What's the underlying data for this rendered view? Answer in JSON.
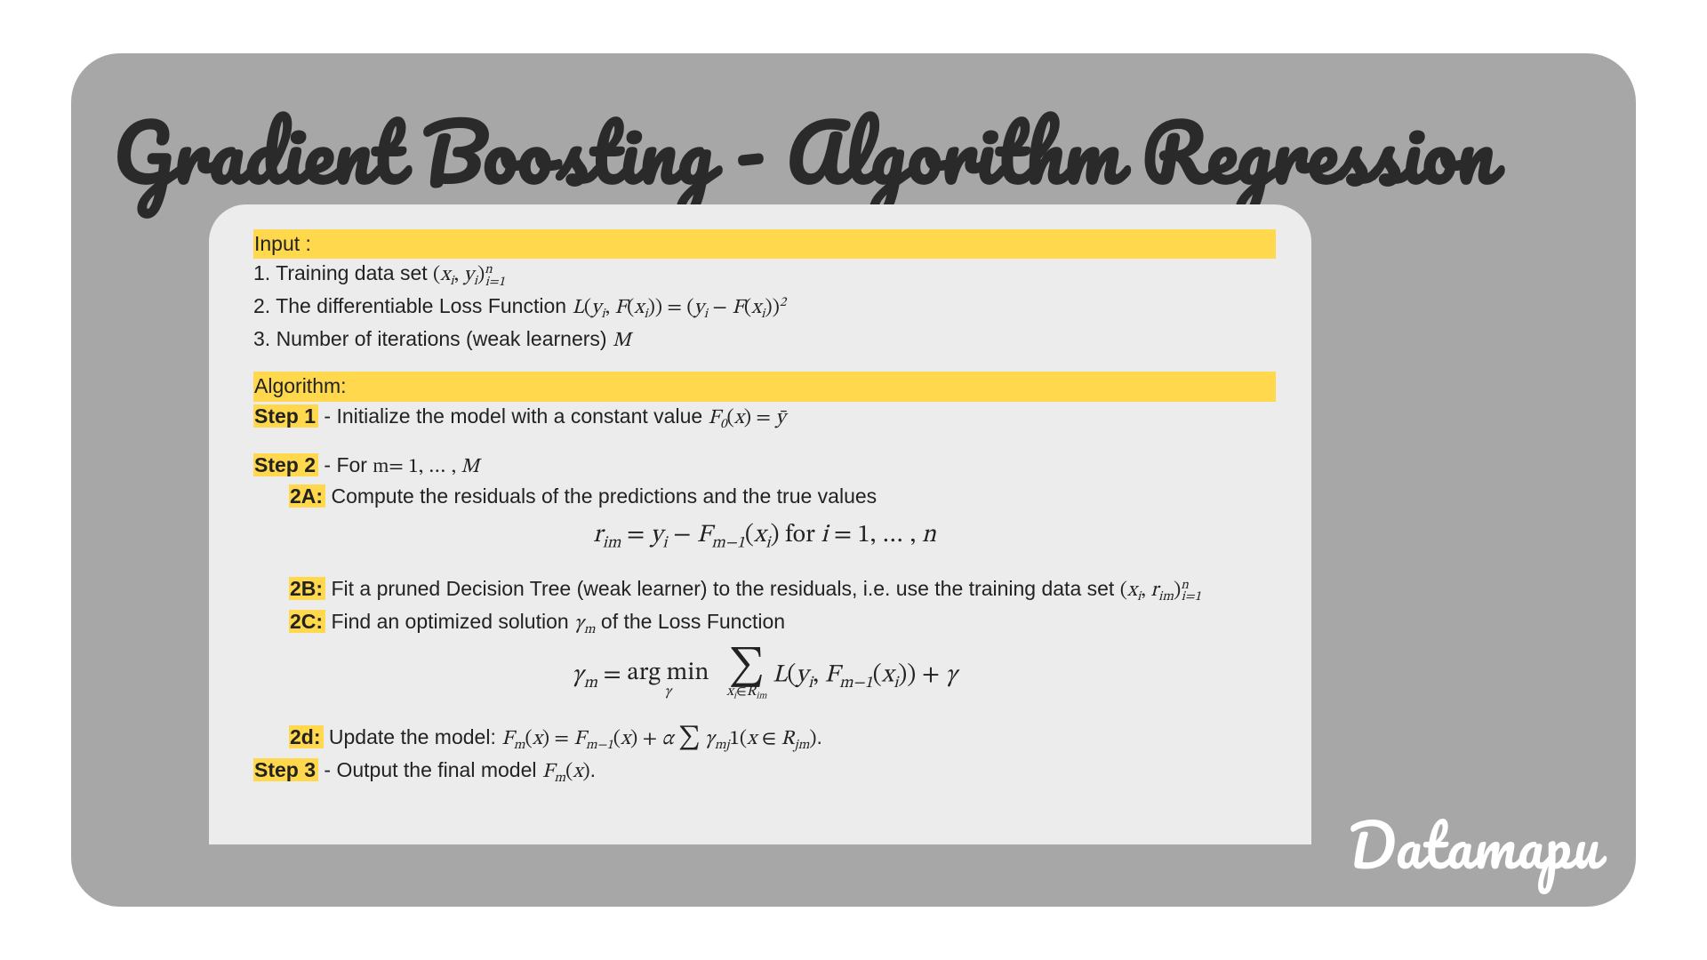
{
  "title": "Gradient Boosting - Algorithm Regression",
  "brand": "Datamapu",
  "sections": {
    "input_heading": "Input :",
    "algorithm_heading": "Algorithm:",
    "input1_pre": "1. Training data set ",
    "input2_pre": "2. The differentiable Loss Function ",
    "input3_pre": "3. Number of iterations (weak learners) ",
    "step1_label": "Step 1",
    "step1_text": " - Initialize the model with a constant value ",
    "step2_label": "Step 2",
    "step2_text_a": " - For ",
    "step2_text_b": "m",
    "s2a_label": "2A:",
    "s2a_text": " Compute the residuals of the predictions and the true values",
    "s2b_label": "2B:",
    "s2b_text": " Fit a pruned Decision Tree (weak learner) to the residuals, i.e. use the training data set ",
    "s2c_label": "2C:",
    "s2c_text_a": " Find an optimized solution ",
    "s2c_text_b": " of the Loss Function",
    "s2d_label": "2d:",
    "s2d_text": " Update the model: ",
    "step3_label": "Step 3",
    "step3_text": " - Output the final model ",
    "math": {
      "trainset": "(x_i, y_i)_{i=1}^{n}",
      "loss": "L(y_i, F(x_i)) = (y_i − F(x_i))^2",
      "M": "M",
      "F0": "F_0(x) = ȳ",
      "m_range": "= 1, … , M",
      "residual": "r_{im} = y_i − F_{m−1}(x_i)  for  i = 1, … , n",
      "trainset_r": "(x_i, r_{im})_{i=1}^{n}",
      "gamma_m": "γ_m",
      "argmin": "γ_m = arg min_γ  Σ_{x_i ∈ R_{im}} L(y_i, F_{m−1}(x_i)) + γ",
      "update": "F_m(x) = F_{m−1}(x) + α Σ γ_{mj} 1(x ∈ R_{jm}).",
      "final": "F_m(x).",
      "period": "."
    }
  }
}
